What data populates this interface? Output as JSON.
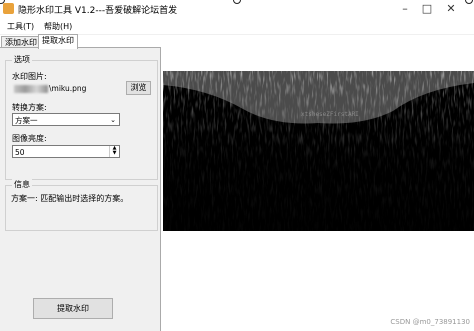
{
  "window": {
    "title": "隐形水印工具 V1.2---吾爱破解论坛首发",
    "minimize": "–",
    "maximize": "□",
    "close": "✕"
  },
  "menu": {
    "tools": "工具(T)",
    "help": "帮助(H)"
  },
  "tabs": [
    {
      "label": "添加水印",
      "active": false
    },
    {
      "label": "提取水印",
      "active": true
    }
  ],
  "options": {
    "group_title": "选项",
    "image_label": "水印图片:",
    "image_path_suffix": "\\miku.png",
    "browse_button": "浏览",
    "method_label": "转换方案:",
    "method_value": "方案一",
    "brightness_label": "图像亮度:",
    "brightness_value": "50"
  },
  "info": {
    "group_title": "信息",
    "text": "方案一: 匹配输出时选择的方案。"
  },
  "extract_button": "提取水印",
  "preview": {
    "watermark_text": "xtsheseZFirstARI"
  },
  "footer": "CSDN @m0_73891130",
  "colors": {
    "preview_bg": "#000000",
    "panel_bg": "#f0f0f0"
  }
}
